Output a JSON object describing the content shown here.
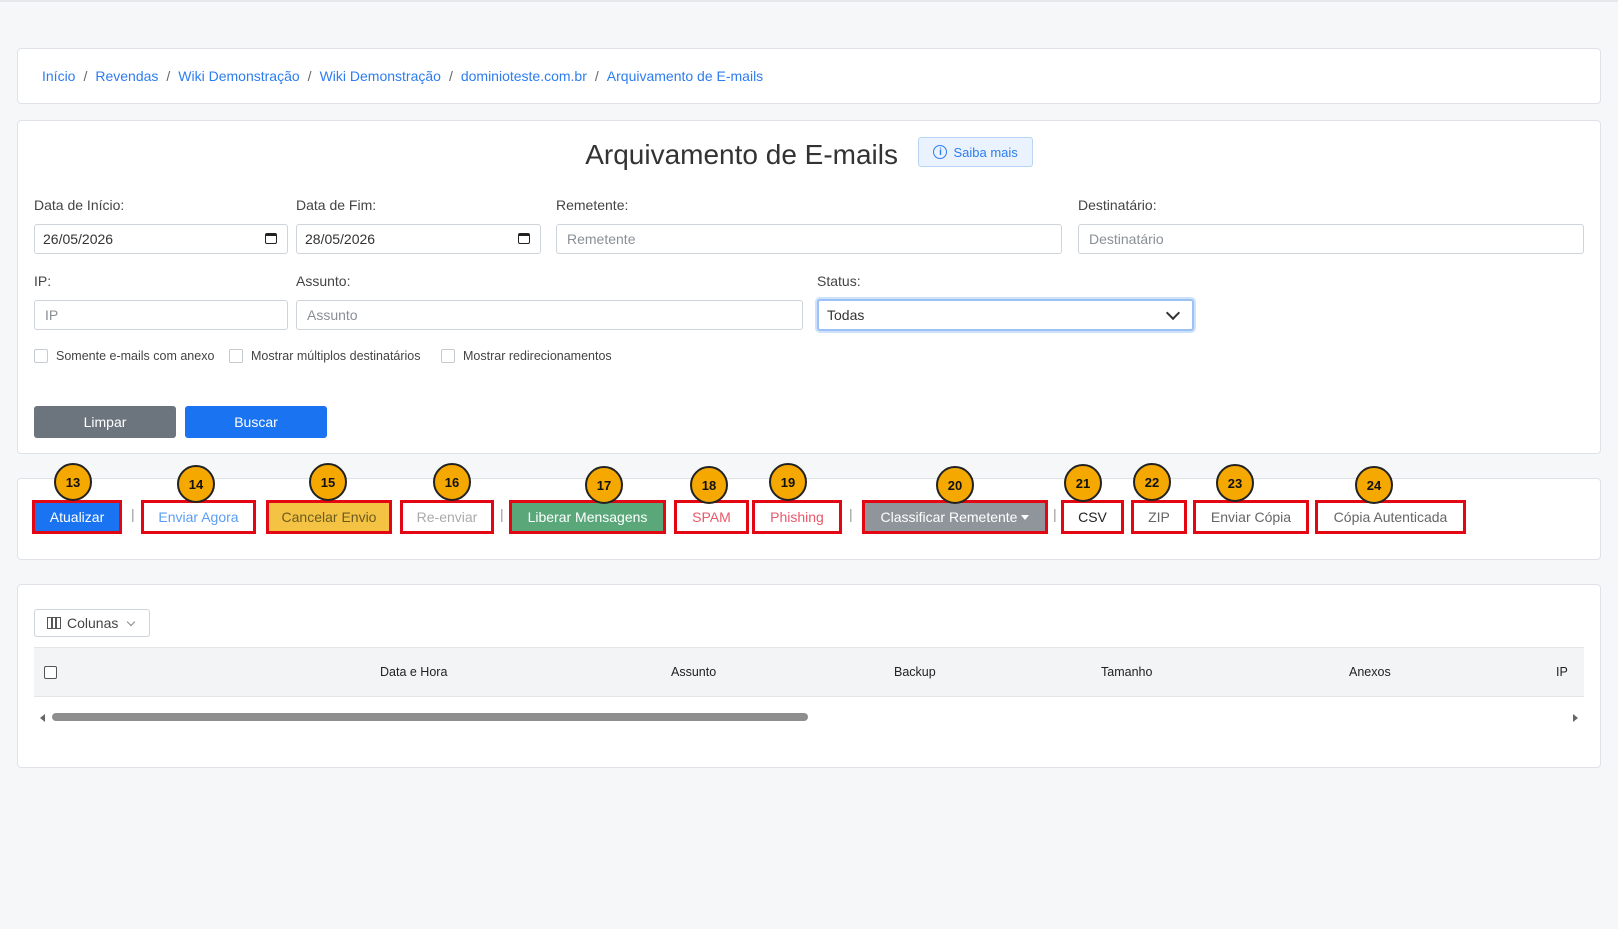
{
  "breadcrumb": [
    "Início",
    "Revendas",
    "Wiki Demonstração",
    "Wiki Demonstração",
    "dominioteste.com.br",
    "Arquivamento de E-mails"
  ],
  "breadcrumb_sep": "/",
  "page": {
    "title": "Arquivamento de E-mails",
    "help_label": "Saiba mais"
  },
  "filters": {
    "start_date": {
      "label": "Data de Início:",
      "value": "26/05/2026"
    },
    "end_date": {
      "label": "Data de Fim:",
      "value": "28/05/2026"
    },
    "sender": {
      "label": "Remetente:",
      "placeholder": "Remetente"
    },
    "recipient": {
      "label": "Destinatário:",
      "placeholder": "Destinatário"
    },
    "ip": {
      "label": "IP:",
      "placeholder": "IP"
    },
    "subject": {
      "label": "Assunto:",
      "placeholder": "Assunto"
    },
    "status": {
      "label": "Status:",
      "value": "Todas"
    },
    "checkboxes": [
      "Somente e-mails com anexo",
      "Mostrar múltiplos destinatários",
      "Mostrar redirecionamentos"
    ],
    "clear_label": "Limpar",
    "search_label": "Buscar"
  },
  "actions": {
    "refresh": "Atualizar",
    "send_now": "Enviar Agora",
    "cancel_send": "Cancelar Envio",
    "resend": "Re-enviar",
    "release": "Liberar Mensagens",
    "spam": "SPAM",
    "phishing": "Phishing",
    "classify": "Classificar Remetente",
    "csv": "CSV",
    "zip": "ZIP",
    "send_copy": "Enviar Cópia",
    "certified_copy": "Cópia Autenticada",
    "separator": "|"
  },
  "badges": [
    "13",
    "14",
    "15",
    "16",
    "17",
    "18",
    "19",
    "20",
    "21",
    "22",
    "23",
    "24"
  ],
  "table": {
    "columns_button": "Colunas",
    "headers": [
      "Data e Hora",
      "Assunto",
      "Backup",
      "Tamanho",
      "Anexos",
      "IP"
    ]
  },
  "colors": {
    "primary": "#1a73f0",
    "secondary": "#6c757d",
    "warning": "#f5c343",
    "success": "#5aa77a",
    "danger_text": "#e8596a",
    "annotation_border": "#e30613",
    "badge": "#f5a800"
  }
}
